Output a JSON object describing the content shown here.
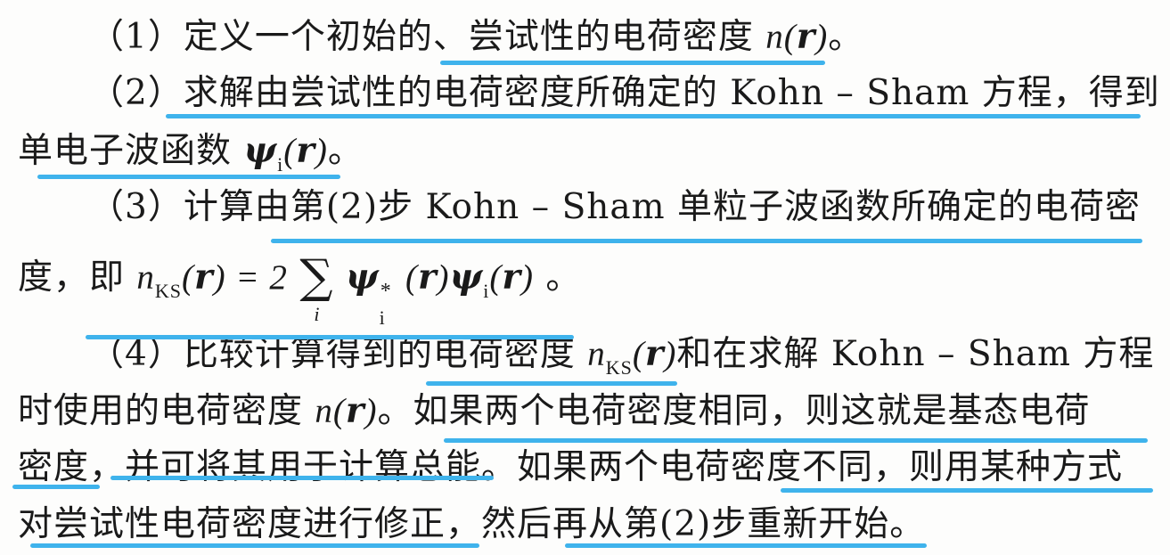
{
  "step1": {
    "num": "（1）",
    "text": "定义一个初始的、尝试性的电荷密度 ",
    "n": "n",
    "paren_open": "(",
    "r": "r",
    "paren_close": ")",
    "end": "。"
  },
  "step2": {
    "num": "（2）",
    "line1": "求解由尝试性的电荷密度所确定的 Kohn – Sham 方程，得到",
    "line2_text": "单电子波函数 ",
    "psi": "ψ",
    "sub_i": "i",
    "paren_open": "(",
    "r": "r",
    "paren_close": ")",
    "end": "。"
  },
  "step3": {
    "num": "（3）",
    "line1": "计算由第(2)步 Kohn – Sham 单粒子波函数所确定的电荷密",
    "line2_text": "度，即 ",
    "n": "n",
    "sub_ks": "KS",
    "paren_open": "(",
    "r": "r",
    "paren_close": ")",
    "equals": " = 2",
    "sum_symbol": "∑",
    "sum_index": "i",
    "psi": "ψ",
    "sub_i": "i",
    "sup_star": "*",
    "end": "。"
  },
  "step4": {
    "num": "（4）",
    "line1": "比较计算得到的电荷密度 ",
    "n": "n",
    "sub_ks": "KS",
    "paren_open": "(",
    "r": "r",
    "paren_close": ")",
    "line1_tail": "和在求解 Kohn – Sham 方程",
    "line2_head": "时使用的电荷密度 ",
    "line2_tail": "。如果两个电荷密度相同，则这就是基态电荷",
    "line3": "密度，并可将其用于计算总能。如果两个电荷密度不同，则用某种方式",
    "line4": "对尝试性电荷密度进行修正，然后再从第(2)步重新开始。"
  },
  "colors": {
    "underline": "#3fb3ec",
    "text": "#1a1a1a",
    "background": "#fdfdfc"
  }
}
